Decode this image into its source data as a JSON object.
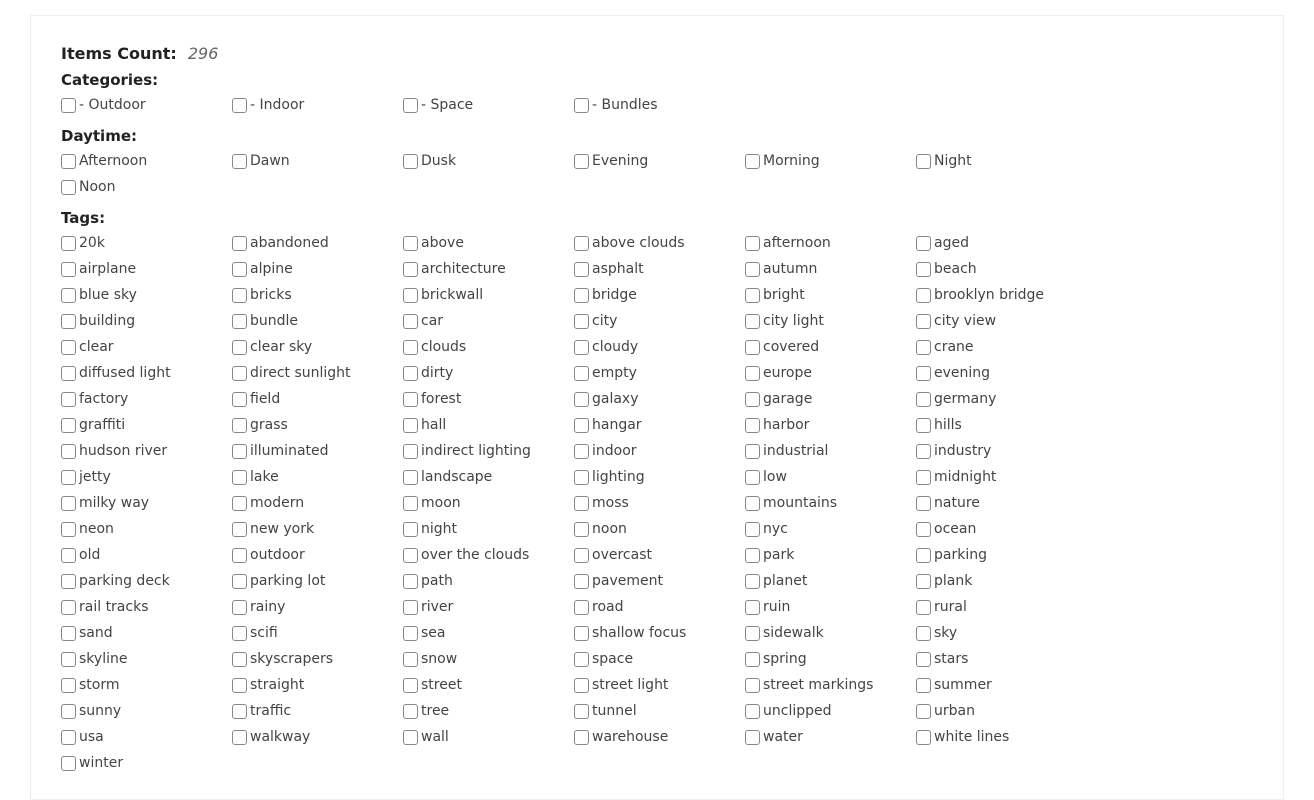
{
  "count": {
    "label": "Items Count:",
    "value": "296"
  },
  "sections": {
    "categories": {
      "label": "Categories:",
      "items": [
        "- Outdoor",
        "- Indoor",
        "- Space",
        "- Bundles"
      ]
    },
    "daytime": {
      "label": "Daytime:",
      "items": [
        "Afternoon",
        "Dawn",
        "Dusk",
        "Evening",
        "Morning",
        "Night",
        "Noon"
      ]
    },
    "tags": {
      "label": "Tags:",
      "items": [
        "20k",
        "abandoned",
        "above",
        "above clouds",
        "afternoon",
        "aged",
        "airplane",
        "alpine",
        "architecture",
        "asphalt",
        "autumn",
        "beach",
        "blue sky",
        "bricks",
        "brickwall",
        "bridge",
        "bright",
        "brooklyn bridge",
        "building",
        "bundle",
        "car",
        "city",
        "city light",
        "city view",
        "clear",
        "clear sky",
        "clouds",
        "cloudy",
        "covered",
        "crane",
        "diffused light",
        "direct sunlight",
        "dirty",
        "empty",
        "europe",
        "evening",
        "factory",
        "field",
        "forest",
        "galaxy",
        "garage",
        "germany",
        "graffiti",
        "grass",
        "hall",
        "hangar",
        "harbor",
        "hills",
        "hudson river",
        "illuminated",
        "indirect lighting",
        "indoor",
        "industrial",
        "industry",
        "jetty",
        "lake",
        "landscape",
        "lighting",
        "low",
        "midnight",
        "milky way",
        "modern",
        "moon",
        "moss",
        "mountains",
        "nature",
        "neon",
        "new york",
        "night",
        "noon",
        "nyc",
        "ocean",
        "old",
        "outdoor",
        "over the clouds",
        "overcast",
        "park",
        "parking",
        "parking deck",
        "parking lot",
        "path",
        "pavement",
        "planet",
        "plank",
        "rail tracks",
        "rainy",
        "river",
        "road",
        "ruin",
        "rural",
        "sand",
        "scifi",
        "sea",
        "shallow focus",
        "sidewalk",
        "sky",
        "skyline",
        "skyscrapers",
        "snow",
        "space",
        "spring",
        "stars",
        "storm",
        "straight",
        "street",
        "street light",
        "street markings",
        "summer",
        "sunny",
        "traffic",
        "tree",
        "tunnel",
        "unclipped",
        "urban",
        "usa",
        "walkway",
        "wall",
        "warehouse",
        "water",
        "white lines",
        "winter"
      ]
    }
  }
}
